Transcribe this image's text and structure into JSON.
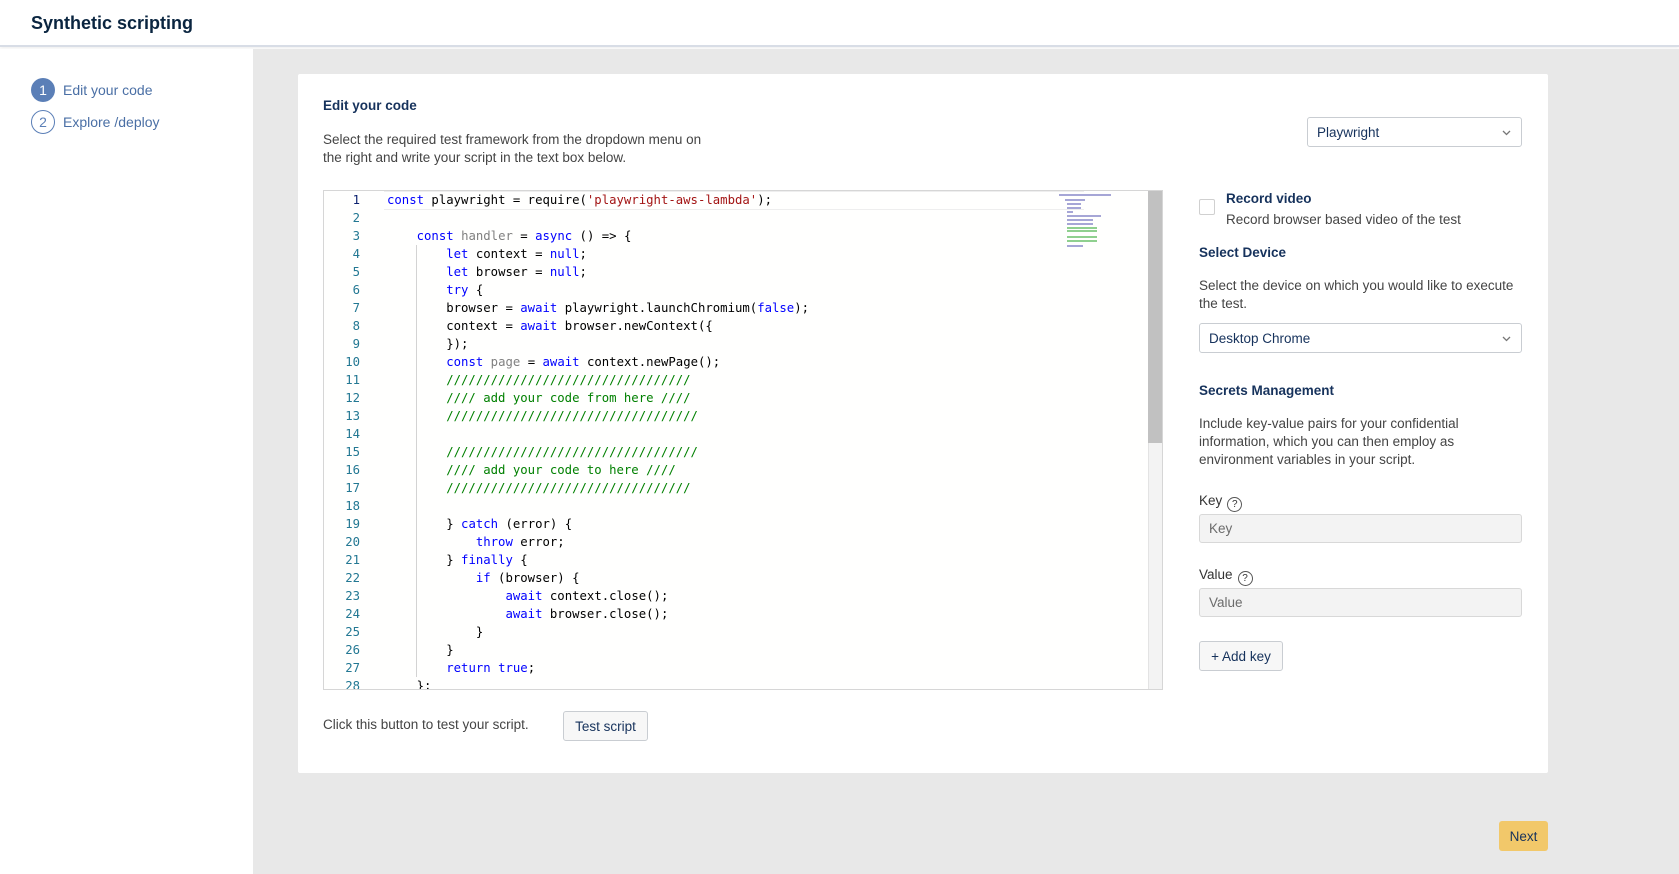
{
  "app": {
    "title": "Synthetic scripting"
  },
  "steps": [
    {
      "number": "1",
      "label": "Edit your code"
    },
    {
      "number": "2",
      "label": "Explore /deploy"
    }
  ],
  "editor_section": {
    "heading": "Edit your code",
    "description": "Select the required test framework from the dropdown menu on the right and write your script in the text box below.",
    "framework_select": {
      "value": "Playwright",
      "icon": "chevron-down-icon"
    }
  },
  "code": {
    "lines": [
      "const playwright = require('playwright-aws-lambda');",
      "",
      "    const handler = async () => {",
      "        let context = null;",
      "        let browser = null;",
      "        try {",
      "        browser = await playwright.launchChromium(false);",
      "        context = await browser.newContext({",
      "        });",
      "        const page = await context.newPage();",
      "        /////////////////////////////////",
      "        //// add your code from here ////",
      "        //////////////////////////////////",
      "",
      "        //////////////////////////////////",
      "        //// add your code to here ////",
      "        /////////////////////////////////",
      "",
      "        } catch (error) {",
      "            throw error;",
      "        } finally {",
      "            if (browser) {",
      "                await context.close();",
      "                await browser.close();",
      "            }",
      "        }",
      "        return true;",
      "    };"
    ],
    "line_numbers": [
      "1",
      "2",
      "3",
      "4",
      "5",
      "6",
      "7",
      "8",
      "9",
      "10",
      "11",
      "12",
      "13",
      "14",
      "15",
      "16",
      "17",
      "18",
      "19",
      "20",
      "21",
      "22",
      "23",
      "24",
      "25",
      "26",
      "27",
      "28"
    ]
  },
  "test": {
    "hint": "Click this button to test your script.",
    "button_label": "Test script"
  },
  "record_video": {
    "label": "Record video",
    "description": "Record browser based video of the test",
    "checked": false
  },
  "device": {
    "heading": "Select Device",
    "description": "Select the device on which you would like to execute the test.",
    "value": "Desktop Chrome",
    "icon": "chevron-down-icon"
  },
  "secrets": {
    "heading": "Secrets Management",
    "description": "Include key-value pairs for your confidential information, which you can then employ as environment variables in your script.",
    "key_label": "Key",
    "key_placeholder": "Key",
    "value_label": "Value",
    "value_placeholder": "Value",
    "help_icon": "question-circle-icon",
    "add_key_label": "+ Add key"
  },
  "footer": {
    "next_label": "Next"
  },
  "colors": {
    "accent": "#5b7fb7",
    "next_button": "#f2c86a",
    "background": "#e8e8e8",
    "keyword": "#0000ff",
    "string": "#a31515",
    "comment": "#008000"
  }
}
